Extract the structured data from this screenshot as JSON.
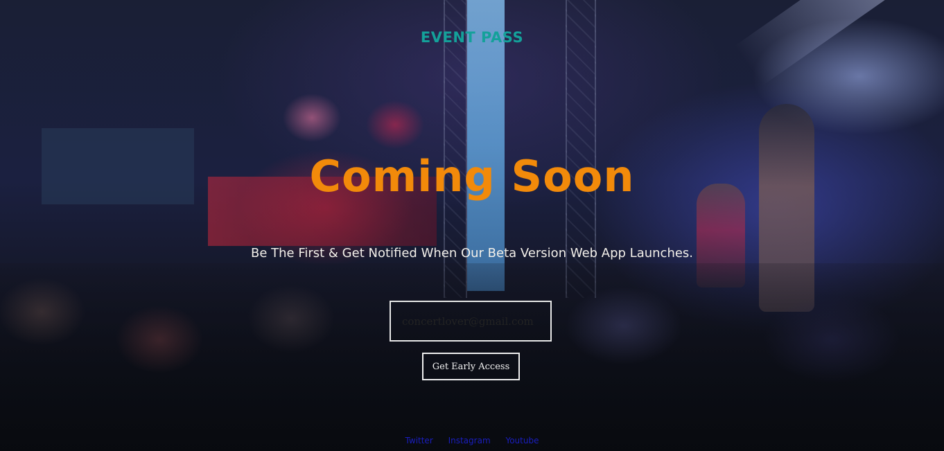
{
  "brand": "EVENT PASS",
  "headline": "Coming Soon",
  "subtitle": "Be The First & Get Notified When Our Beta Version Web App Launches.",
  "signup": {
    "email_placeholder": "concertlover@gmail.com",
    "email_value": "",
    "button_label": "Get Early Access"
  },
  "social_links": [
    "Twitter",
    "Instagram",
    "Youtube"
  ],
  "colors": {
    "brand": "#14a19a",
    "headline": "#f28a0a",
    "subtitle": "#f3f0ea",
    "links": "#1a1ec0"
  }
}
